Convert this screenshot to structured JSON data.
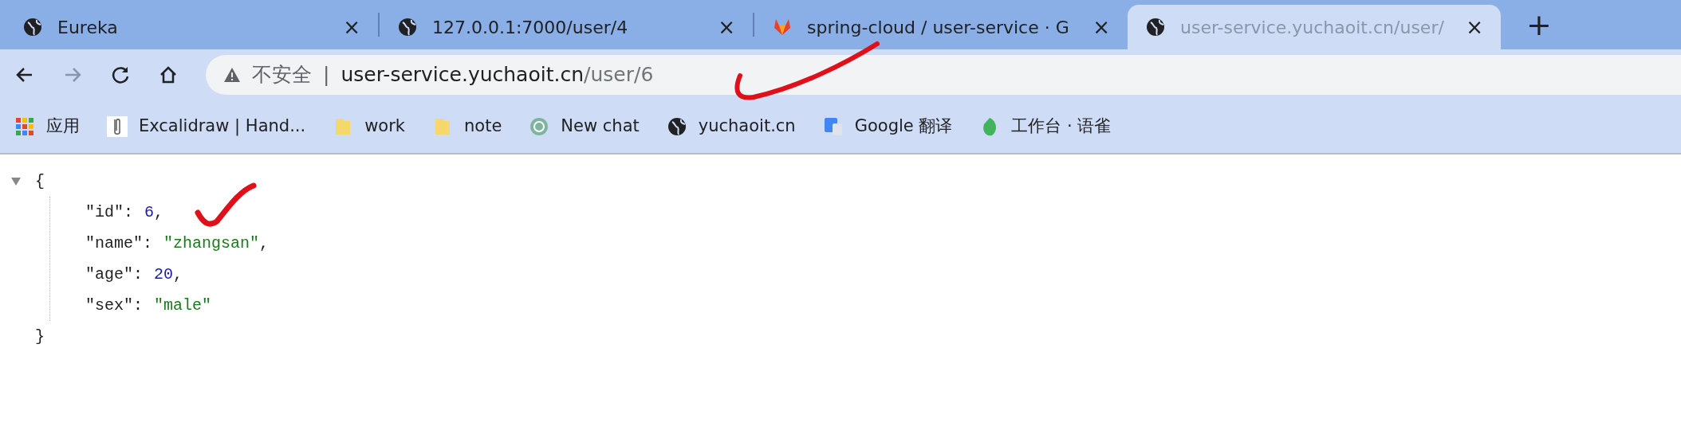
{
  "tabs": [
    {
      "title": "Eureka",
      "kind": "globe",
      "close": "×",
      "selected": false
    },
    {
      "title": "127.0.0.1:7000/user/4",
      "kind": "globe",
      "close": "×",
      "selected": false
    },
    {
      "title": "spring-cloud / user-service · G",
      "kind": "fox",
      "close": "×",
      "selected": false
    },
    {
      "title": "user-service.yuchaoit.cn/user/",
      "kind": "globe",
      "close": "×",
      "selected": true
    }
  ],
  "new_tab": "+",
  "address_bar": {
    "security": "不安全",
    "separator": "|",
    "host": "user-service.yuchaoit.cn",
    "path": "/user/6"
  },
  "bookmarks": [
    {
      "label": "应用",
      "kind": "apps"
    },
    {
      "label": "Excalidraw | Hand...",
      "kind": "clip"
    },
    {
      "label": "work",
      "kind": "folder"
    },
    {
      "label": "note",
      "kind": "folder"
    },
    {
      "label": "New chat",
      "kind": "chat"
    },
    {
      "label": "yuchaoit.cn",
      "kind": "globe"
    },
    {
      "label": "Google 翻译",
      "kind": "translate"
    },
    {
      "label": "工作台 · 语雀",
      "kind": "leaf"
    }
  ],
  "json_view": {
    "expanded": true,
    "open": "{",
    "close": "}",
    "lines": [
      {
        "key": "\"id\"",
        "colon": ":",
        "value": "6",
        "kind": "number",
        "after": ","
      },
      {
        "key": "\"name\"",
        "colon": ":",
        "value": "\"zhangsan\"",
        "kind": "string",
        "after": ","
      },
      {
        "key": "\"age\"",
        "colon": ":",
        "value": "20",
        "kind": "number",
        "after": ","
      },
      {
        "key": "\"sex\"",
        "colon": ":",
        "value": "\"male\"",
        "kind": "string"
      }
    ]
  }
}
